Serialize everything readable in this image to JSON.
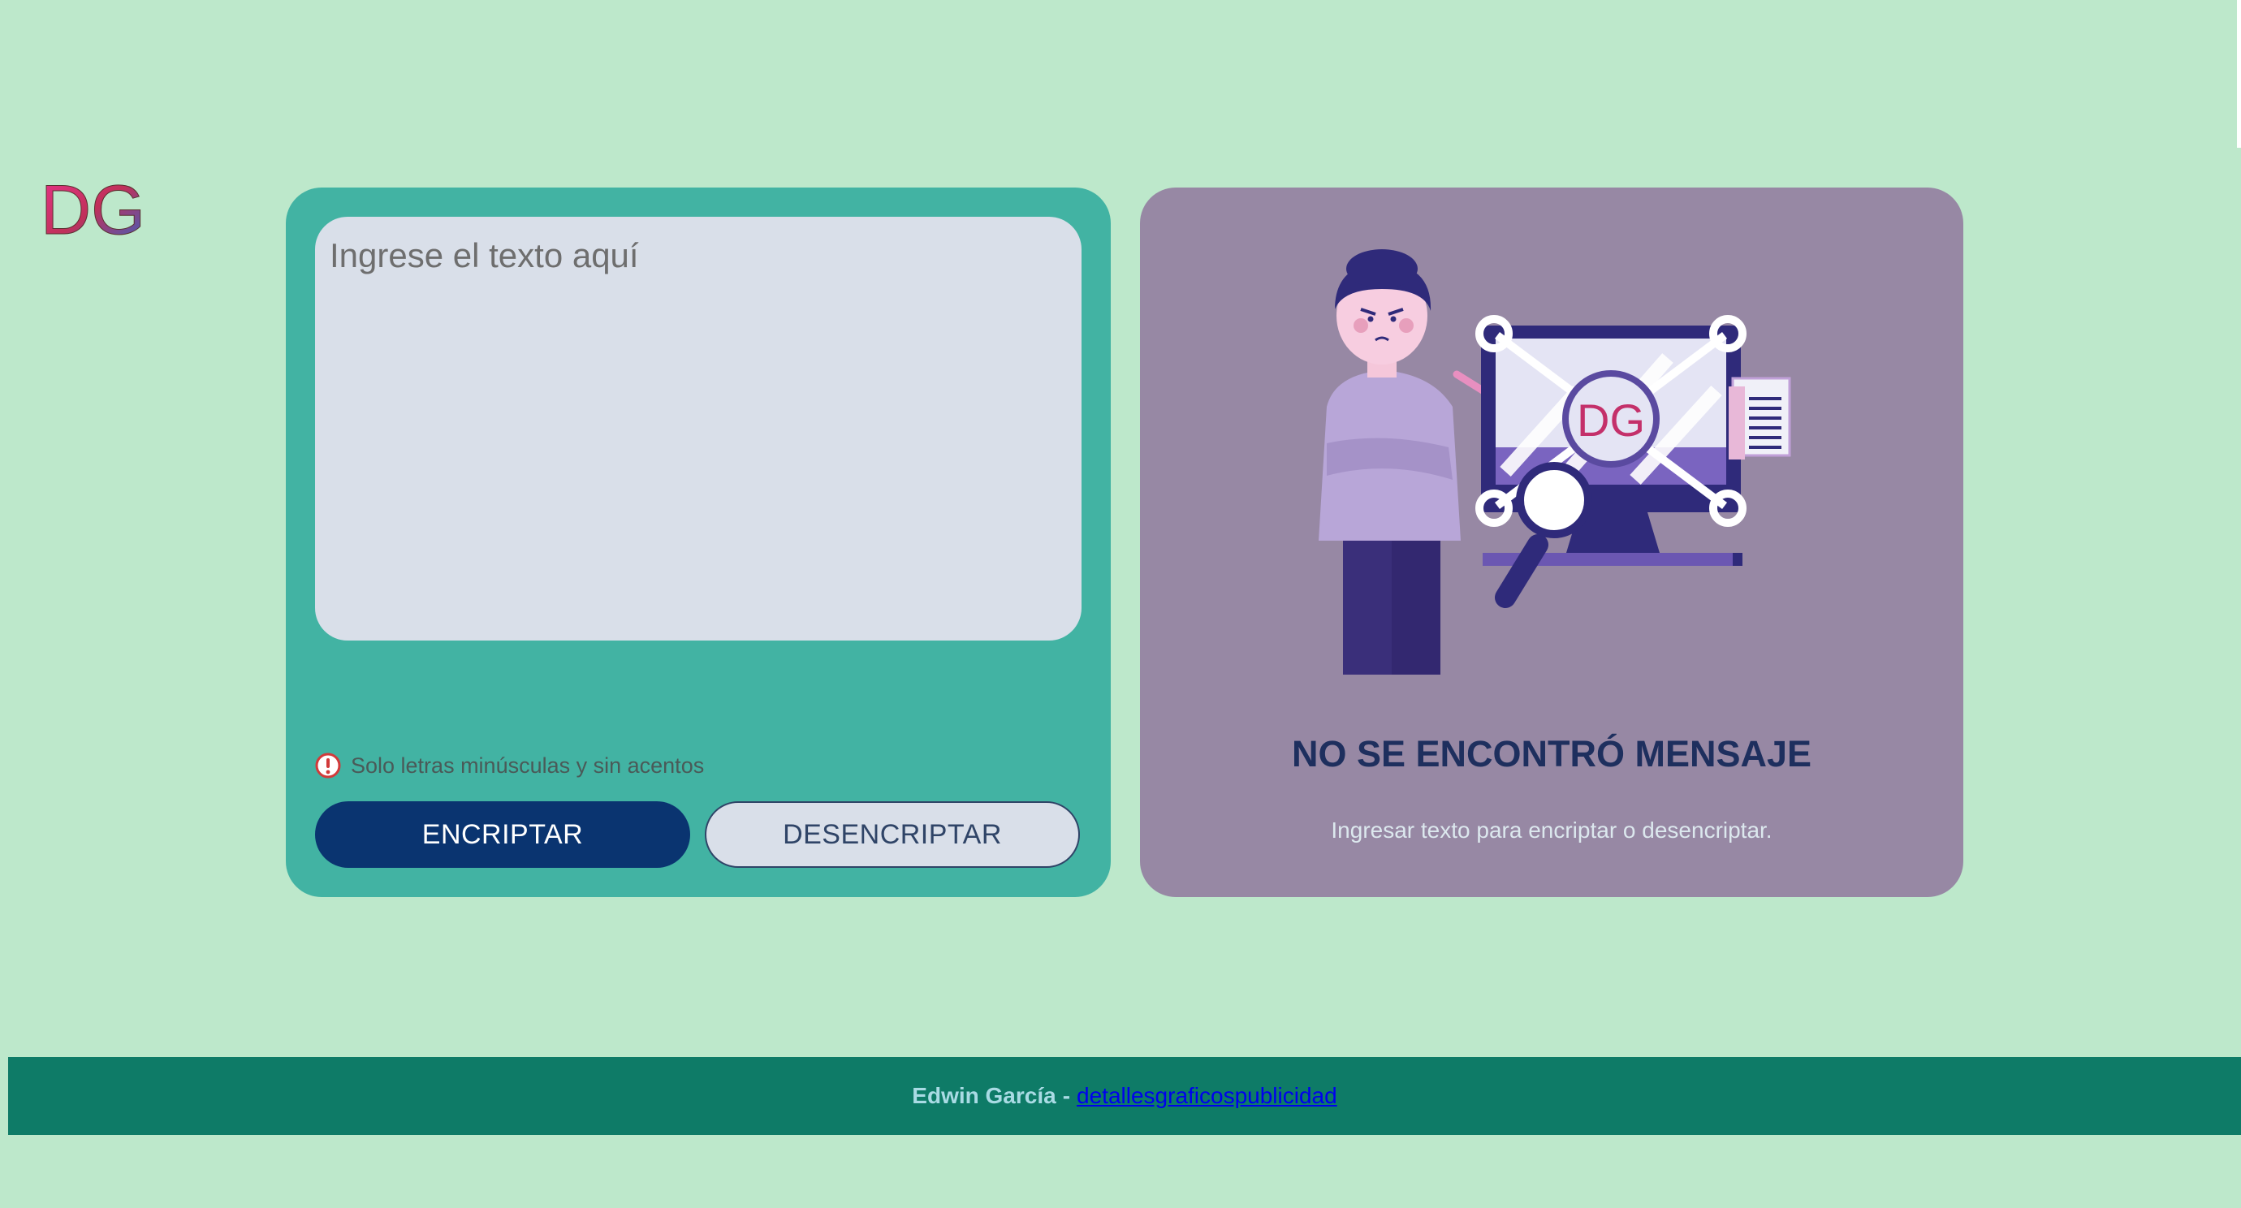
{
  "brand": {
    "logo_text": "DG"
  },
  "input": {
    "placeholder": "Ingrese el texto aquí",
    "value": ""
  },
  "hint": {
    "text": "Solo letras minúsculas y sin acentos"
  },
  "buttons": {
    "encrypt_label": "ENCRIPTAR",
    "decrypt_label": "DESENCRIPTAR"
  },
  "output": {
    "illustration_logo": "DG",
    "title": "NO SE ENCONTRÓ MENSAJE",
    "subtitle": "Ingresar texto para encriptar o desencriptar."
  },
  "footer": {
    "author": "Edwin García",
    "separator": "-",
    "link_text": "detallesgraficospublicidad"
  },
  "colors": {
    "background": "#bde8cb",
    "input_panel": "#42b3a3",
    "output_panel": "#9788a4",
    "primary_button": "#0a3470",
    "footer": "#0e7b67"
  },
  "icons": [
    "dg-logo",
    "warning-icon",
    "person-illustration",
    "locked-monitor-illustration"
  ]
}
